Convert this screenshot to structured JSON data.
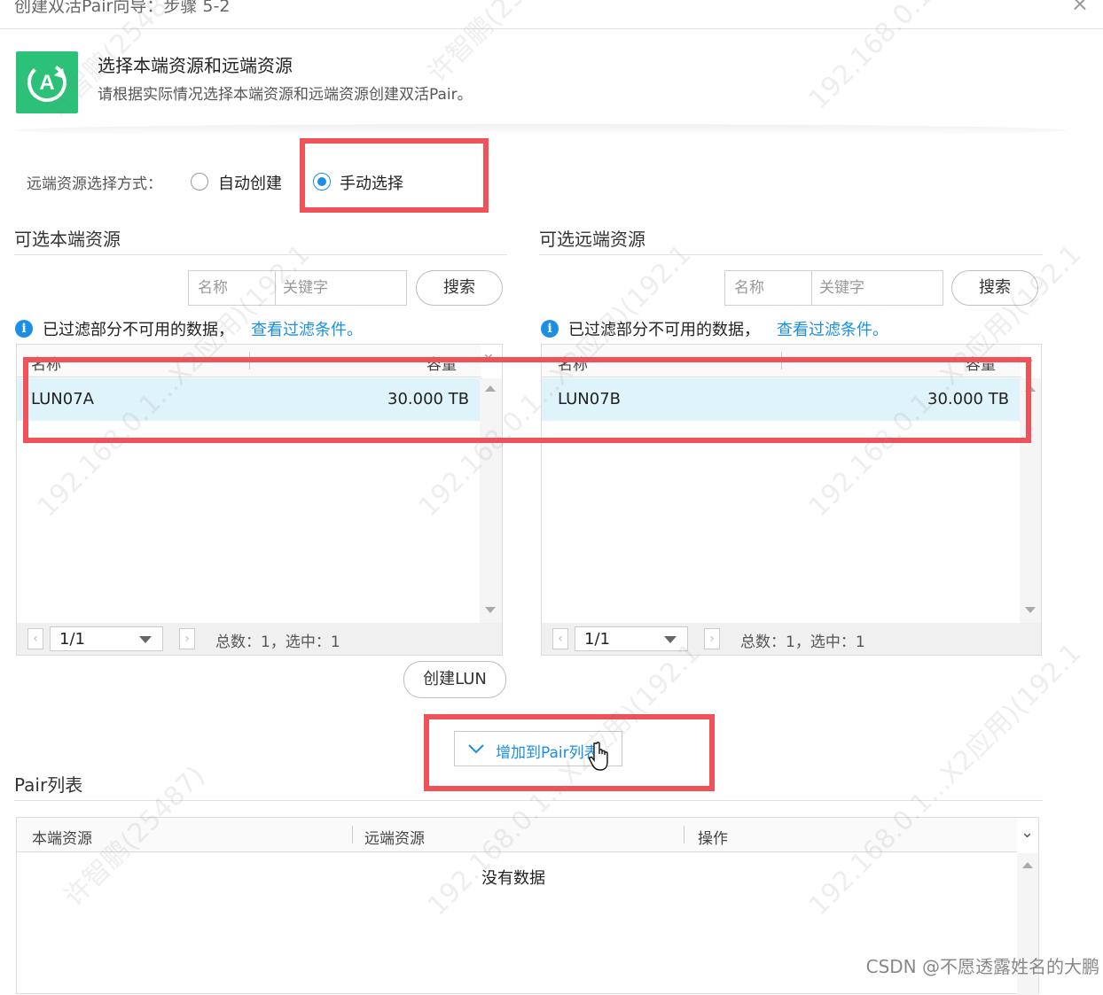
{
  "window": {
    "title": "创建双活Pair向导：步骤 5-2",
    "close_label": "×"
  },
  "header": {
    "icon": "app-a-icon",
    "title": "选择本端资源和远端资源",
    "subtitle": "请根据实际情况选择本端资源和远端资源创建双活Pair。"
  },
  "mode": {
    "label": "远端资源选择方式：",
    "options": [
      {
        "label": "自动创建",
        "selected": false
      },
      {
        "label": "手动选择",
        "selected": true
      }
    ]
  },
  "local": {
    "title": "可选本端资源",
    "search_field": "名称",
    "search_placeholder": "关键字",
    "search_button": "搜索",
    "filter_notice": "已过滤部分不可用的数据，",
    "filter_link": "查看过滤条件。",
    "columns": [
      "名称",
      "容量"
    ],
    "rows": [
      {
        "name": "LUN07A",
        "capacity": "30.000 TB",
        "selected": true
      }
    ],
    "page": "1/1",
    "summary": "总数：1，选中：1",
    "create_button": "创建LUN"
  },
  "remote": {
    "title": "可选远端资源",
    "search_field": "名称",
    "search_placeholder": "关键字",
    "search_button": "搜索",
    "filter_notice": "已过滤部分不可用的数据，",
    "filter_link": "查看过滤条件。",
    "columns": [
      "名称",
      "容量"
    ],
    "rows": [
      {
        "name": "LUN07B",
        "capacity": "30.000 TB",
        "selected": true
      }
    ],
    "page": "1/1",
    "summary": "总数：1，选中：1"
  },
  "add_button": "增加到Pair列表",
  "pair_list": {
    "title": "Pair列表",
    "columns": [
      "本端资源",
      "远端资源",
      "操作"
    ],
    "empty_text": "没有数据"
  },
  "watermark_lines": [
    "许智鹏(25487)",
    "192.168.0.1...X2应用)(192.1"
  ],
  "footer_credit": "CSDN @不愿透露姓名的大鹏",
  "colors": {
    "accent": "#1a8fe3",
    "icon_green": "#2cc179",
    "highlight_red": "#f0525a",
    "selected_row": "#dff3fb"
  }
}
